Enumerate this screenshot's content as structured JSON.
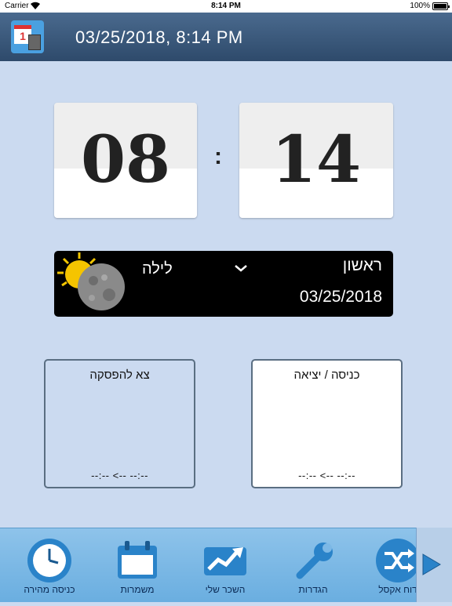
{
  "status_bar": {
    "carrier": "Carrier",
    "time": "8:14 PM",
    "battery": "100%"
  },
  "header": {
    "title": "03/25/2018, 8:14 PM",
    "app_icon_day": "1"
  },
  "clock": {
    "hours": "08",
    "separator": ":",
    "minutes": "14"
  },
  "day_panel": {
    "period": "לילה",
    "weekday": "ראשון",
    "date": "03/25/2018",
    "weather_icon": "moon-sun-icon"
  },
  "boxes": {
    "break": {
      "label": "צא להפסקה",
      "range": "--:--  <--  --:--"
    },
    "entry": {
      "label": "כניסה / יציאה",
      "range": "--:--  <--  --:--"
    }
  },
  "toolbar": {
    "items": [
      {
        "label": "כניסה מהירה",
        "icon": "clock-icon"
      },
      {
        "label": "משמרות",
        "icon": "calendar-icon"
      },
      {
        "label": "השכר שלי",
        "icon": "chart-arrow-icon"
      },
      {
        "label": "הגדרות",
        "icon": "wrench-icon"
      },
      {
        "label": "דוח אקסל",
        "icon": "shuffle-icon"
      }
    ],
    "next_icon": "play-arrow-icon"
  },
  "colors": {
    "background": "#cbdaf0",
    "header": "#3a5878",
    "toolbar": "#7cb8e6",
    "panel": "#000000"
  }
}
